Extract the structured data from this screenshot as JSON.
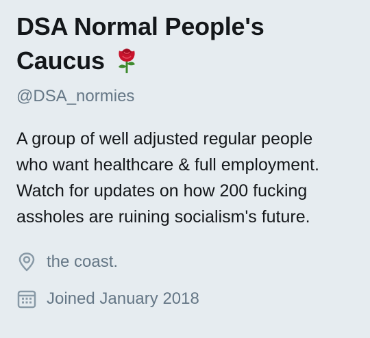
{
  "profile": {
    "display_name_line1": "DSA Normal People's",
    "display_name_line2": "Caucus",
    "name_icon": "rose-icon",
    "handle": "@DSA_normies",
    "bio_lines": [
      "A group of well adjusted regular people",
      "who want healthcare & full employment.",
      "Watch for updates on how 200 fucking",
      "assholes are ruining socialism's future."
    ],
    "location": "the coast.",
    "location_icon": "location-pin-icon",
    "joined": "Joined January 2018",
    "joined_icon": "calendar-icon"
  },
  "colors": {
    "background": "#e6ecf0",
    "name_text": "#14171a",
    "secondary_text": "#657786",
    "rose_red": "#c8142c",
    "rose_green": "#3f8a2e"
  }
}
